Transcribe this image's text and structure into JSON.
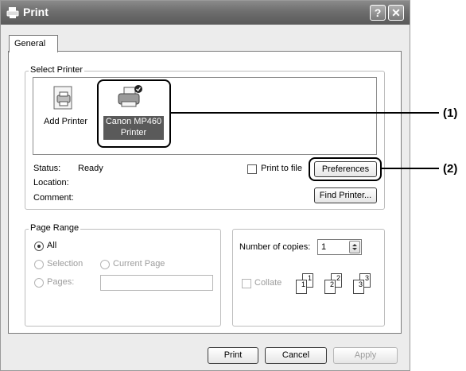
{
  "window": {
    "title": "Print",
    "help_button": "?",
    "close_button": "✕"
  },
  "tabs": [
    {
      "label": "General"
    }
  ],
  "select_printer": {
    "group_label": "Select Printer",
    "printers": [
      {
        "label": "Add Printer"
      },
      {
        "label_line1": "Canon MP460",
        "label_line2": "Printer"
      }
    ],
    "status_label": "Status:",
    "status_value": "Ready",
    "location_label": "Location:",
    "comment_label": "Comment:",
    "print_to_file_label": "Print to file",
    "preferences_button": "Preferences",
    "find_printer_button": "Find Printer..."
  },
  "page_range": {
    "group_label": "Page Range",
    "all_label": "All",
    "selection_label": "Selection",
    "current_page_label": "Current Page",
    "pages_label": "Pages:",
    "pages_value": ""
  },
  "copies": {
    "label": "Number of copies:",
    "value": "1",
    "collate_label": "Collate",
    "collate_pages": [
      "1",
      "1",
      "2",
      "2",
      "3",
      "3"
    ]
  },
  "footer": {
    "print_button": "Print",
    "cancel_button": "Cancel",
    "apply_button": "Apply"
  },
  "callouts": [
    "(1)",
    "(2)"
  ]
}
